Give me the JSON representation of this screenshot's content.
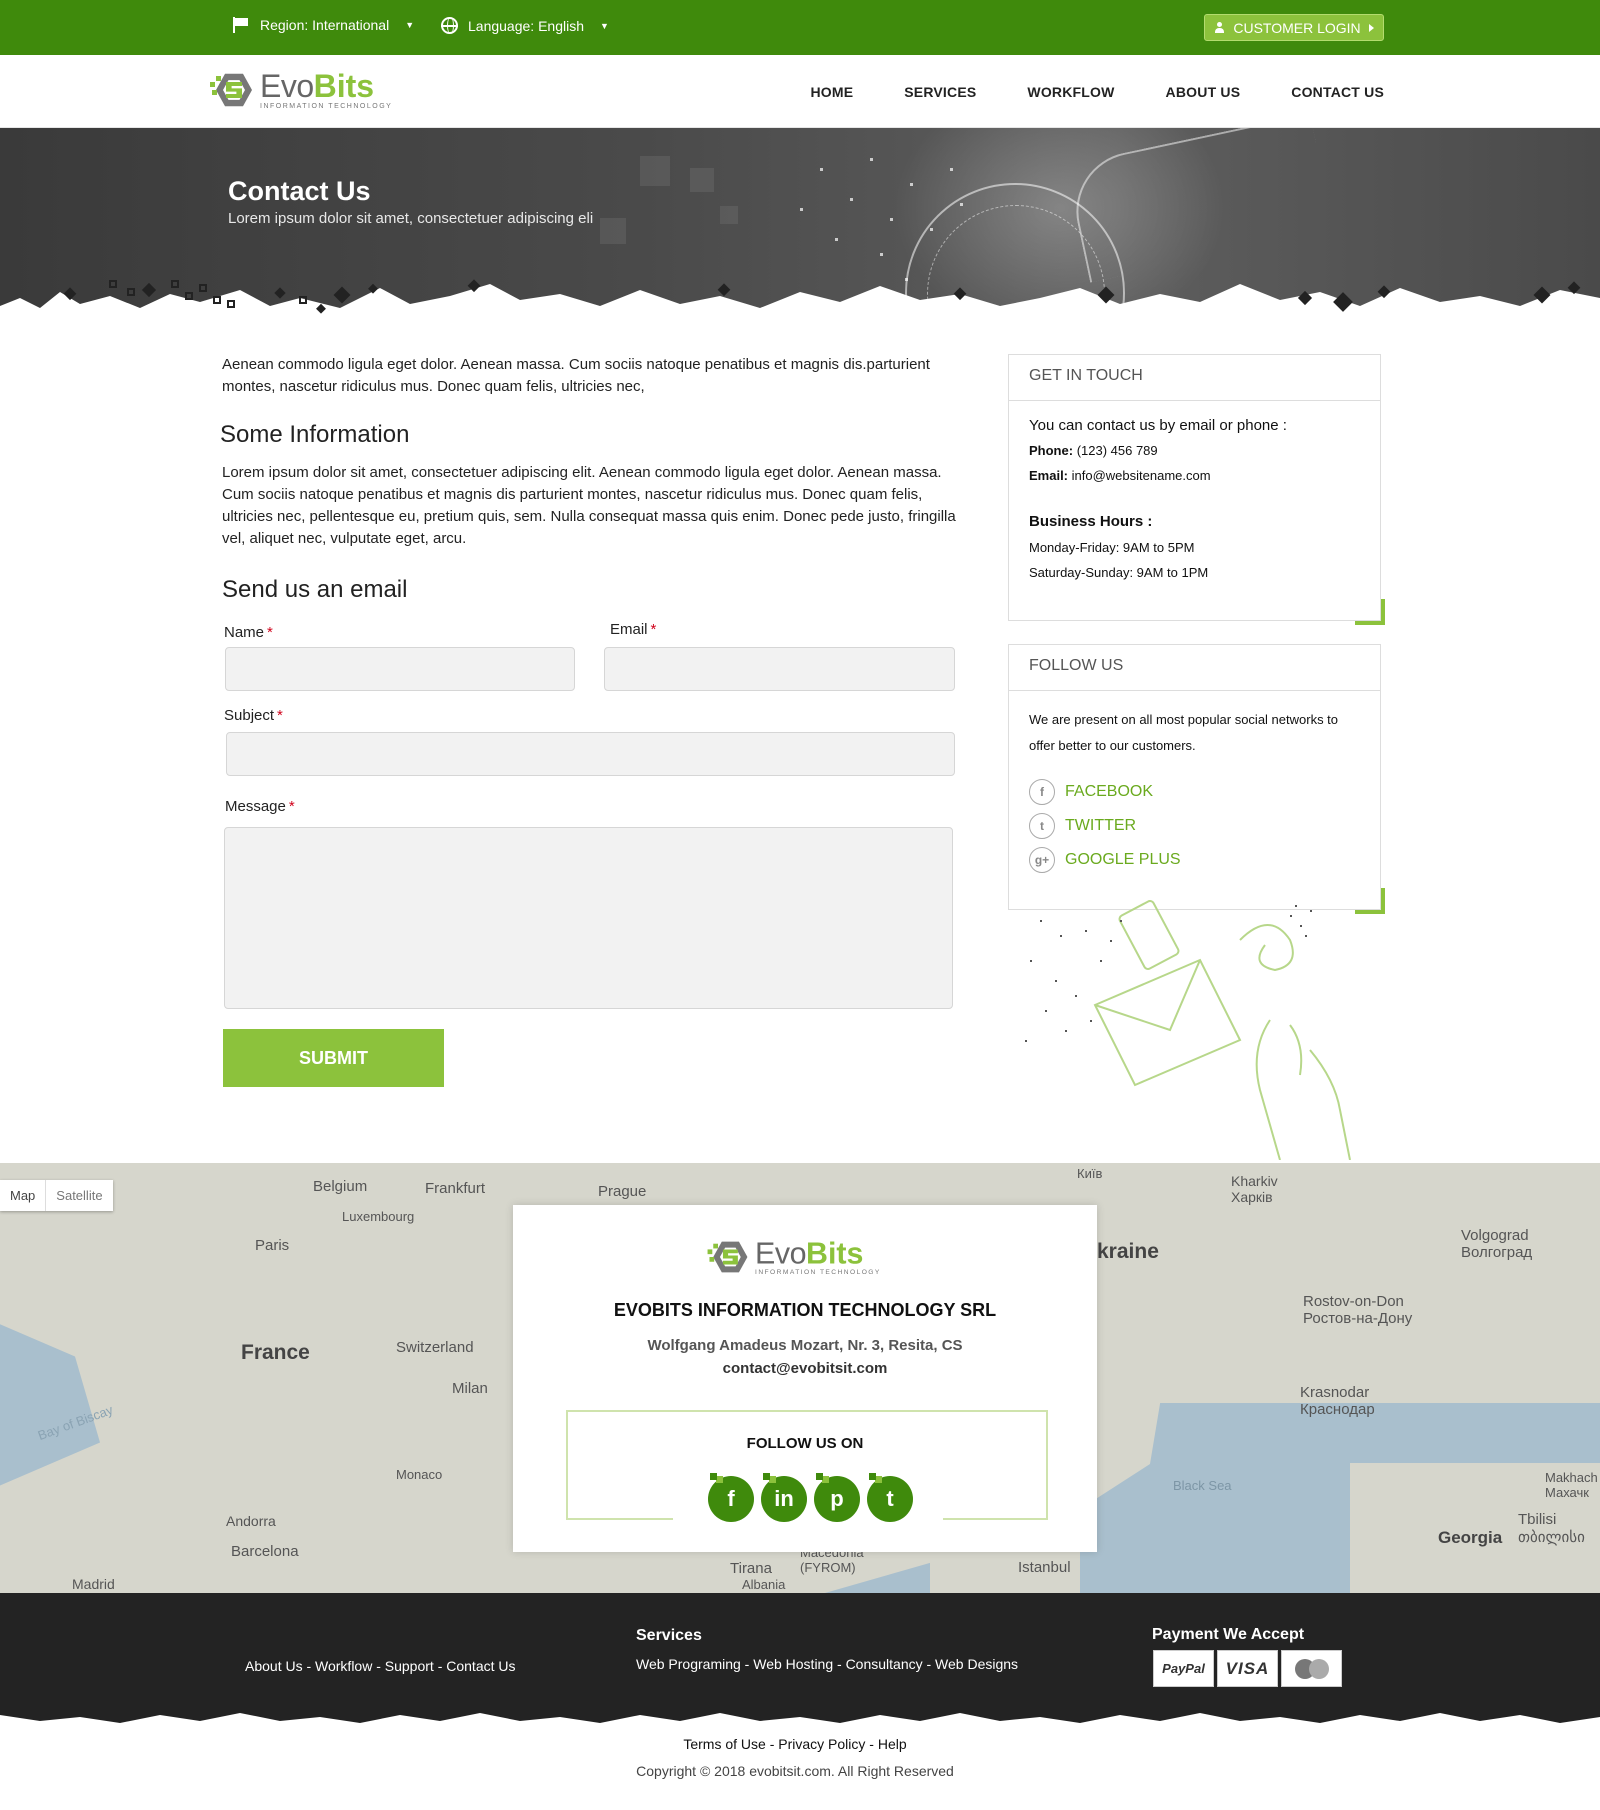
{
  "topbar": {
    "region_label": "Region: International",
    "language_label": "Language: English",
    "login_label": "CUSTOMER LOGIN"
  },
  "logo": {
    "word_evo": "Evo",
    "word_bits": "Bits",
    "tagline": "INFORMATION TECHNOLOGY"
  },
  "nav": {
    "items": [
      "HOME",
      "SERVICES",
      "WORKFLOW",
      "ABOUT US",
      "CONTACT US"
    ]
  },
  "hero": {
    "title": "Contact Us",
    "subtitle": "Lorem ipsum dolor sit amet, consectetuer adipiscing eli"
  },
  "main": {
    "intro": "Aenean commodo ligula eget dolor. Aenean massa. Cum sociis natoque penatibus et magnis dis.parturient montes, nascetur ridiculus mus. Donec quam felis, ultricies nec,",
    "info_heading": "Some Information",
    "info_text": "Lorem ipsum dolor sit amet, consectetuer adipiscing elit. Aenean commodo ligula eget dolor. Aenean massa. Cum sociis natoque penatibus et magnis dis parturient montes, nascetur ridiculus mus. Donec quam felis, ultricies nec, pellentesque eu, pretium quis, sem. Nulla consequat massa quis enim. Donec pede justo, fringilla vel, aliquet nec, vulputate eget, arcu.",
    "form_heading": "Send us an email"
  },
  "form": {
    "name_label": "Name",
    "email_label": "Email",
    "subject_label": "Subject",
    "message_label": "Message",
    "required_mark": "*",
    "name_value": "",
    "email_value": "",
    "subject_value": "",
    "message_value": "",
    "submit_label": "SUBMIT"
  },
  "get_in_touch": {
    "title": "GET IN TOUCH",
    "intro": "You can contact us by email or phone :",
    "phone_label": "Phone:",
    "phone_value": "(123) 456 789",
    "email_label": "Email:",
    "email_value": "info@websitename.com",
    "hours_title": "Business Hours :",
    "hours_weekday": "Monday-Friday: 9AM to 5PM",
    "hours_weekend": "Saturday-Sunday: 9AM to 1PM"
  },
  "follow_us": {
    "title": "FOLLOW US",
    "text": "We are present on all most popular social networks to offer better to our customers.",
    "networks": [
      {
        "icon": "facebook-icon",
        "glyph": "f",
        "label": "FACEBOOK"
      },
      {
        "icon": "twitter-icon",
        "glyph": "t",
        "label": "TWITTER"
      },
      {
        "icon": "google-plus-icon",
        "glyph": "g+",
        "label": "GOOGLE PLUS"
      }
    ]
  },
  "map": {
    "toggle_map": "Map",
    "toggle_satellite": "Satellite",
    "labels": [
      "Belgium",
      "Frankfurt",
      "Prague",
      "Luxembourg",
      "Paris",
      "France",
      "Switzerland",
      "Milan",
      "Monaco",
      "Andorra",
      "Barcelona",
      "Madrid",
      "Bay of Biscay",
      "Tirana",
      "Albania",
      "Macedonia (FYROM)",
      "Istanbul",
      "Київ",
      "Kharkiv Харків",
      "kraine",
      "Volgograd Волгоград",
      "Rostov-on-Don Ростов-на-Дону",
      "Krasnodar Краснодар",
      "Black Sea",
      "Georgia",
      "Tbilisi თბილისი",
      "Makhach Махачк"
    ]
  },
  "card": {
    "company": "EVOBITS INFORMATION TECHNOLOGY SRL",
    "address": "Wolfgang Amadeus Mozart, Nr. 3, Resita, CS",
    "email": "contact@evobitsit.com",
    "follow_label": "FOLLOW US ON",
    "socials": [
      {
        "icon": "facebook-icon",
        "glyph": "f"
      },
      {
        "icon": "linkedin-icon",
        "glyph": "in"
      },
      {
        "icon": "pinterest-icon",
        "glyph": "p"
      },
      {
        "icon": "twitter-icon",
        "glyph": "t"
      }
    ]
  },
  "footer": {
    "links": "About Us - Workflow - Support - Contact Us",
    "services_title": "Services",
    "services_links": "Web Programing - Web Hosting - Consultancy - Web Designs",
    "payment_title": "Payment We Accept",
    "payments": [
      "PayPal",
      "VISA",
      "MasterCard"
    ],
    "bottom_links": "Terms of Use - Privacy Policy - Help",
    "copyright": "Copyright  ©  2018 evobitsit.com. All Right Reserved"
  },
  "colors": {
    "brand_green": "#3f8a0c",
    "accent_green": "#8cc23c",
    "footer_dark": "#232323"
  }
}
